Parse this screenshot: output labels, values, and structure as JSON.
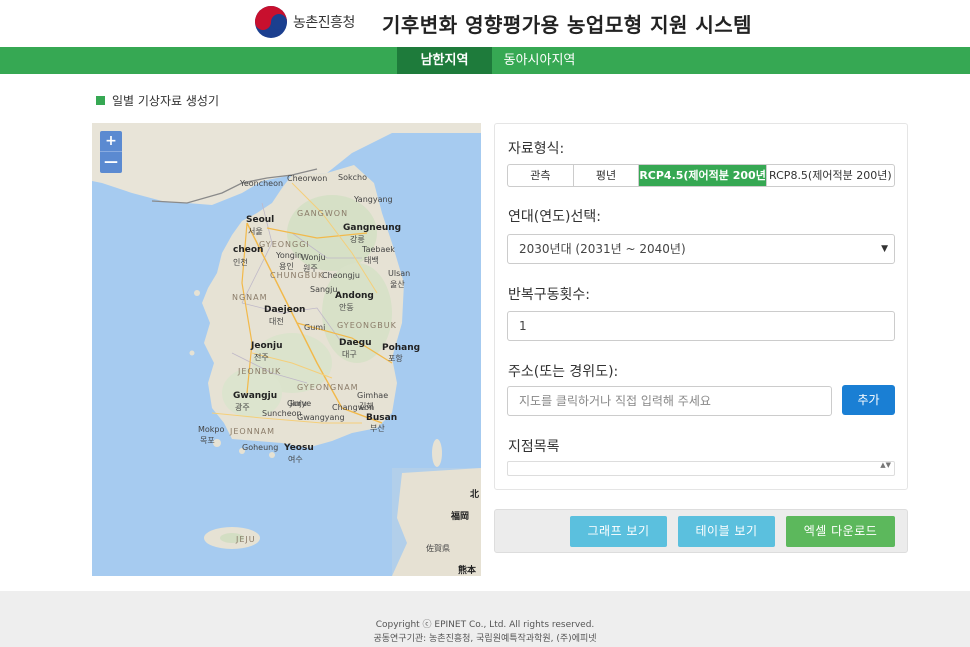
{
  "header": {
    "logo_text": "농촌진흥청",
    "title": "기후변화 영향평가용 농업모형 지원 시스템"
  },
  "nav": {
    "tabs": [
      {
        "label": "남한지역",
        "active": true
      },
      {
        "label": "동아시아지역",
        "active": false
      }
    ]
  },
  "section": {
    "title": "일별 기상자료 생성기"
  },
  "map": {
    "zoom_in": "+",
    "zoom_out": "—",
    "labels": {
      "seoul": "Seoul",
      "seoul_ko": "서울",
      "incheon": "cheon",
      "incheon_ko": "인천",
      "yongin": "Yongin",
      "yongin_ko": "용인",
      "wonju": "Wonju",
      "wonju_ko": "원주",
      "gangneung": "Gangneung",
      "gangneung_ko": "강릉",
      "taebaek": "Taebaek",
      "taebaek_ko": "태백",
      "ulsan": "Ulsan",
      "ulsan_ko": "울산",
      "daejeon": "Daejeon",
      "daejeon_ko": "대전",
      "andong": "Andong",
      "andong_ko": "안동",
      "daegu": "Daegu",
      "daegu_ko": "대구",
      "pohang": "Pohang",
      "pohang_ko": "포항",
      "jeonju": "Jeonju",
      "jeonju_ko": "전주",
      "gwangju": "Gwangju",
      "gwangju_ko": "광주",
      "busan": "Busan",
      "busan_ko": "부산",
      "gimhae": "Gimhae",
      "gimhae_ko": "김해",
      "yeosu": "Yeosu",
      "yeosu_ko": "여수",
      "mokpo": "Mokpo",
      "mokpo_ko": "목포",
      "jeju": "JEJU",
      "gangwon": "GANGWON",
      "gyeonggi": "GYEONGGI",
      "chungbuk": "CHUNGBUK",
      "jeonbuk": "JEONBUK",
      "gyeongbuk": "GYEONGBUK",
      "gyeongnam": "GYEONGNAM",
      "jeonnam": "JEONNAM",
      "yeoncheon": "Yeoncheon",
      "cheorwon": "Cheorwon",
      "sokcho": "Sokcho",
      "yangyang": "Yangyang",
      "cheongju": "Cheongju",
      "chungnam": "NGNAM",
      "sangju": "Sangju",
      "gumi": "Gumi",
      "changwon": "Changwon",
      "jinju": "Jinju",
      "suncheon": "Suncheon",
      "gwangyang": "Gwangyang",
      "gurye": "Gurye",
      "goheung": "Goheung",
      "fukuoka": "福岡",
      "saga": "佐賀県",
      "kumamoto": "熊本",
      "kita": "北"
    }
  },
  "form": {
    "data_type_label": "자료형식:",
    "data_types": [
      "관측",
      "평년",
      "RCP4.5(제어적분 200년)",
      "RCP8.5(제어적분 200년)"
    ],
    "decade_label": "연대(연도)선택:",
    "decade_value": "2030년대 (2031년 ~ 2040년)",
    "decade_arrow": "▼",
    "repeat_label": "반복구동횟수:",
    "repeat_value": "1",
    "address_label": "주소(또는 경위도):",
    "address_placeholder": "지도를 클릭하거나 직접 입력해 주세요",
    "add_button": "추가",
    "list_label": "지점목록",
    "list_spin": "▲▼"
  },
  "actions": {
    "graph": "그래프 보기",
    "table": "테이블 보기",
    "excel": "엑셀 다운로드"
  },
  "footer": {
    "copyright": "Copyright ⓒ EPINET Co., Ltd. All rights reserved.",
    "partners": "공동연구기관: 농촌진흥청, 국립원예특작과학원, (주)에피넷"
  },
  "colors": {
    "brand_green": "#36a853",
    "nav_active": "#1e7b3b",
    "add_blue": "#1a7fd4",
    "info_cyan": "#5bc0de",
    "success_green": "#5cb85c",
    "sea": "#a6cbf0"
  }
}
